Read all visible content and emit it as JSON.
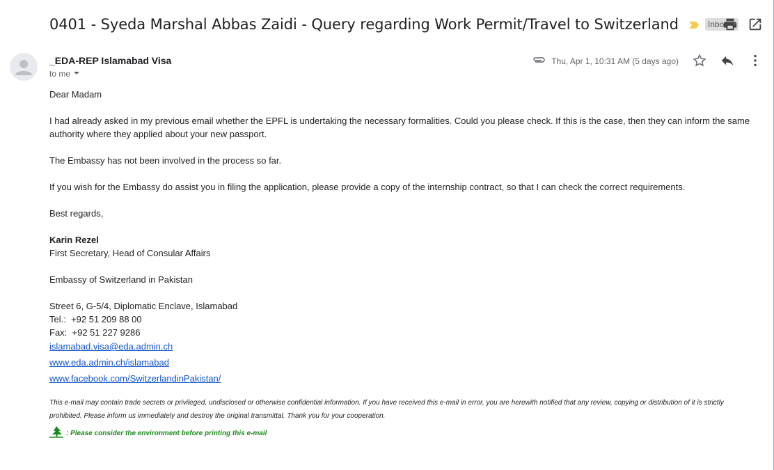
{
  "header": {
    "subject": "0401 - Syeda Marshal Abbas Zaidi - Query regarding Work Permit/Travel to Switzerland",
    "inbox_label": "Inbox",
    "inbox_remove": "×"
  },
  "message": {
    "sender": "_EDA-REP Islamabad Visa",
    "recipient": "to me",
    "date": "Thu, Apr 1, 10:31 AM (5 days ago)"
  },
  "body": {
    "greeting": "Dear Madam",
    "p1": "I had already asked in my previous email whether the EPFL is undertaking the necessary formalities. Could you please check. If this is the case, then they can inform the same authority where they applied about your new passport.",
    "p2": "The Embassy has not been involved in the process so far.",
    "p3": "If you wish for the Embassy do assist you in filing the application, please provide a copy of the internship contract, so that I can check the correct requirements.",
    "closing": "Best regards,"
  },
  "signature": {
    "name": "Karin Rezel",
    "title": "First Secretary, Head of Consular Affairs",
    "org": "Embassy of Switzerland in Pakistan",
    "address": "Street 6, G-5/4, Diplomatic Enclave, Islamabad",
    "tel": "Tel.:  +92 51 209 88 00",
    "fax": "Fax:  +92 51 227 9286",
    "email": "islamabad.visa@eda.admin.ch",
    "web": "www.eda.admin.ch/islamabad",
    "facebook": "www.facebook.com/SwitzerlandinPakistan/"
  },
  "footer": {
    "disclaimer": "This e-mail may contain trade secrets or privileged, undisclosed or otherwise confidential information. If you have received this e-mail in error, you are herewith notified that any review, copying or distribution of it is strictly prohibited. Please inform us immediately and destroy the original transmittal. Thank you for your cooperation.",
    "environment": ": Please consider the environment before printing this e-mail"
  },
  "colors": {
    "link": "#1155cc",
    "label_marker": "#f7cb4d",
    "environment_text": "#1a8a1a"
  },
  "icons": [
    "label-importance-icon",
    "print-icon",
    "open-in-new-window-icon",
    "avatar-icon",
    "chevron-down-icon",
    "attachment-icon",
    "star-icon",
    "reply-icon",
    "more-vert-icon",
    "tree-icon"
  ]
}
